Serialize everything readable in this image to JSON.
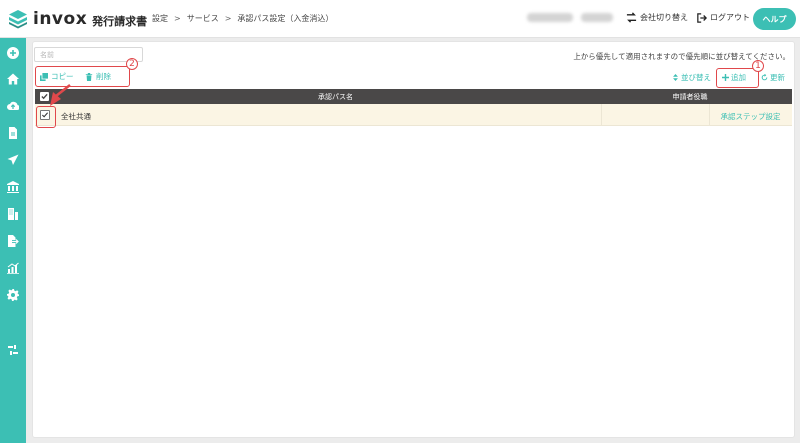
{
  "app": {
    "logo_text": "invox",
    "logo_sub": "発行請求書"
  },
  "breadcrumb": {
    "items": [
      "設定",
      "サービス",
      "承認パス設定（入金消込）"
    ],
    "sep": ">"
  },
  "header": {
    "switch_company": "会社切り替え",
    "logout": "ログアウト",
    "help": "ヘルプ"
  },
  "sidebar": {
    "icons": [
      "plus-circle-icon",
      "home-icon",
      "cloud-upload-icon",
      "document-icon",
      "send-icon",
      "bank-icon",
      "building-icon",
      "export-icon",
      "chart-icon",
      "gear-icon",
      "tools-icon"
    ]
  },
  "toolbar": {
    "name_placeholder": "名前",
    "info": "上から優先して適用されますので優先順に並び替えてください。",
    "copy": "コピー",
    "delete": "削除",
    "sort": "並び替え",
    "add": "追加",
    "refresh": "更新"
  },
  "table": {
    "headers": [
      "承認パス名",
      "申請者役職"
    ],
    "rows": [
      {
        "name": "全社共通",
        "role": "",
        "action": "承認ステップ設定",
        "checked": true
      }
    ]
  },
  "annotations": {
    "num_1": "1",
    "num_2": "2"
  },
  "colors": {
    "accent": "#3cbfb4",
    "header_dark": "#4a4848",
    "row_highlight": "#fbf5e4",
    "annotation": "#e0484b"
  }
}
